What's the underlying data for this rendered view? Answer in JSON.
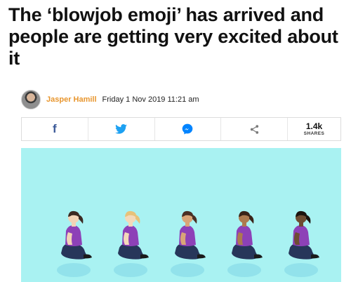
{
  "article": {
    "title": "The ‘blowjob emoji’ has arrived and people are getting very excited about it"
  },
  "byline": {
    "author": "Jasper Hamill",
    "date": "Friday 1 Nov 2019 11:21 am"
  },
  "share": {
    "facebook_glyph": "f",
    "count": "1.4k",
    "count_label": "SHARES"
  },
  "colors": {
    "image_bg": "#a9f2f2",
    "author": "#e8962e",
    "facebook": "#3b5998",
    "twitter": "#1da1f2",
    "messenger": "#0084ff",
    "share_icon": "#7a7a7a"
  },
  "emoji_figures": [
    {
      "skin": "#f2d3b6",
      "hair": "#3b2a22"
    },
    {
      "skin": "#f4d9b9",
      "hair": "#e7c27a"
    },
    {
      "skin": "#d9a577",
      "hair": "#4a3025"
    },
    {
      "skin": "#ad7a4f",
      "hair": "#3a2419"
    },
    {
      "skin": "#6e4c32",
      "hair": "#1c140f"
    }
  ]
}
